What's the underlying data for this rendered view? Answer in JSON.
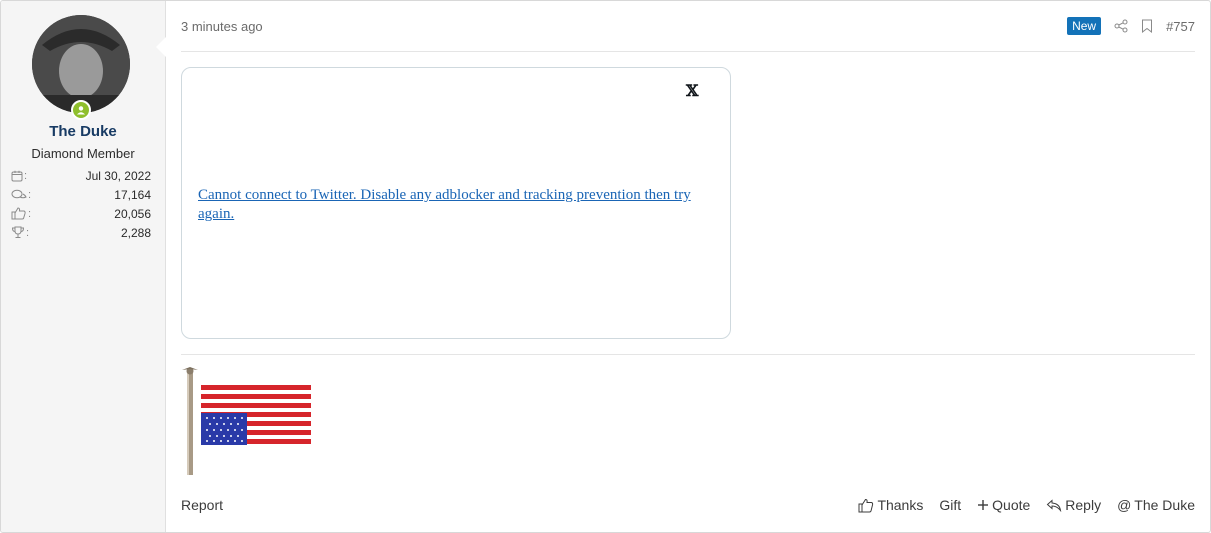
{
  "user": {
    "name": "The Duke",
    "title": "Diamond Member",
    "avatar_icon": "avatar-photo",
    "online_icon": "online-status-icon",
    "stats": [
      {
        "icon": "calendar-icon",
        "value": "Jul 30, 2022"
      },
      {
        "icon": "messages-icon",
        "value": "17,164"
      },
      {
        "icon": "reactions-icon",
        "value": "20,056"
      },
      {
        "icon": "trophy-icon",
        "value": "2,288"
      }
    ]
  },
  "post": {
    "time": "3 minutes ago",
    "badge": "New",
    "number": "#757",
    "embed": {
      "x_label": "𝕏",
      "link_text": "Cannot connect to Twitter. Disable any adblocker and tracking prevention then try again."
    }
  },
  "footer": {
    "report": "Report",
    "thanks": "Thanks",
    "gift": "Gift",
    "quote": "Quote",
    "reply": "Reply",
    "mention": "The Duke"
  },
  "colors": {
    "accent": "#1372b8",
    "username": "#183b64",
    "online": "#8fbf2d",
    "link": "#1a65b5"
  }
}
